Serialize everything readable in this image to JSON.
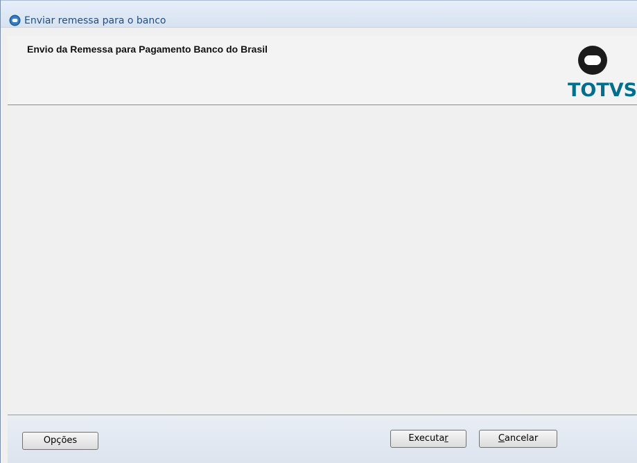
{
  "window": {
    "title": "Enviar remessa para o banco",
    "icon": "totvs-circle-icon"
  },
  "header": {
    "title": "Envio da Remessa para Pagamento Banco do Brasil",
    "logo_text": "TOTVS",
    "logo_color": "#006e8c"
  },
  "footer": {
    "options_label": "Opções",
    "execute_label": "Executar",
    "cancel_label": "Cancelar"
  }
}
